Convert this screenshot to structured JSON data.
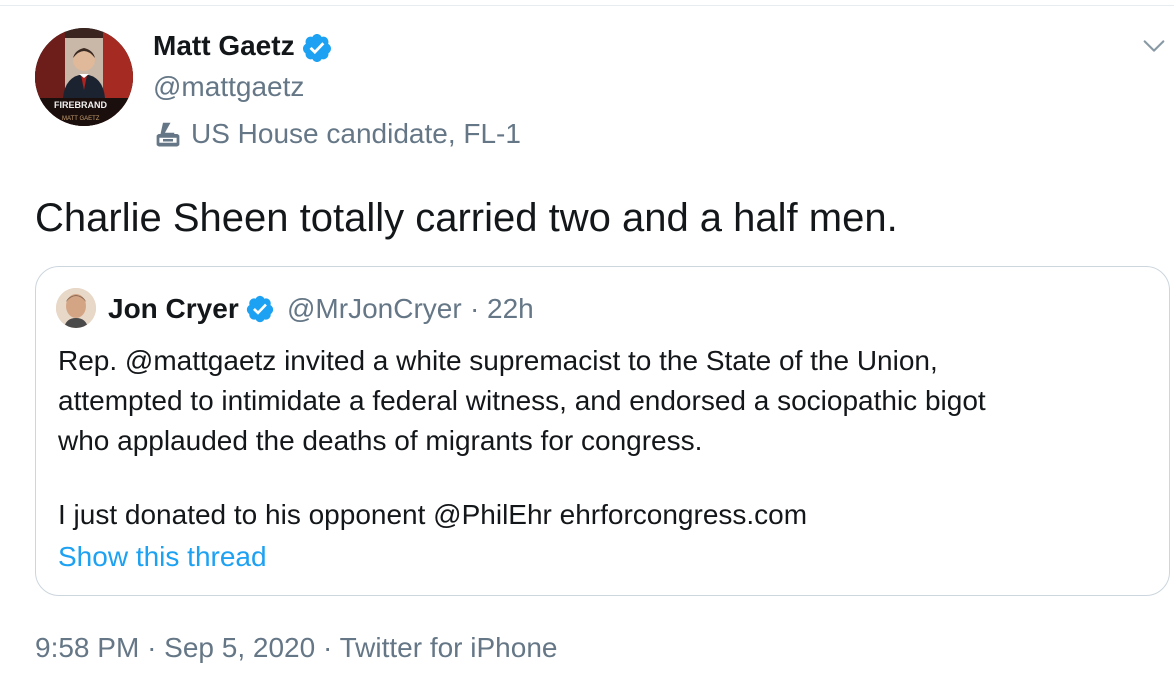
{
  "tweet": {
    "author": {
      "name": "Matt Gaetz",
      "handle": "@mattgaetz",
      "label": "US House candidate, FL-1",
      "avatar_text": "FIREBRAND",
      "avatar_subtext": "MATT GAETZ",
      "verified_color": "#1da1f2"
    },
    "text": "Charlie Sheen totally carried two and a half men.",
    "quoted": {
      "author": {
        "name": "Jon Cryer",
        "handle": "@MrJonCryer",
        "time": "22h"
      },
      "separator": "·",
      "lines": [
        "Rep. @mattgaetz invited a white supremacist to the State of the Union,",
        "attempted to intimidate a federal witness, and endorsed a sociopathic bigot",
        "who applauded the deaths of migrants for congress."
      ],
      "last_line": "I just donated to his opponent @PhilEhr  ehrforcongress.com",
      "show_thread": "Show this thread"
    },
    "footer": {
      "time": "9:58 PM",
      "date": "Sep 5, 2020",
      "source": "Twitter for iPhone",
      "separator": "·"
    }
  },
  "colors": {
    "text": "#14171a",
    "secondary": "#657786",
    "accent": "#1da1f2",
    "border": "#ccd6dd"
  },
  "icons": [
    "verified-badge-icon",
    "ballot-box-icon",
    "chevron-down-icon"
  ]
}
